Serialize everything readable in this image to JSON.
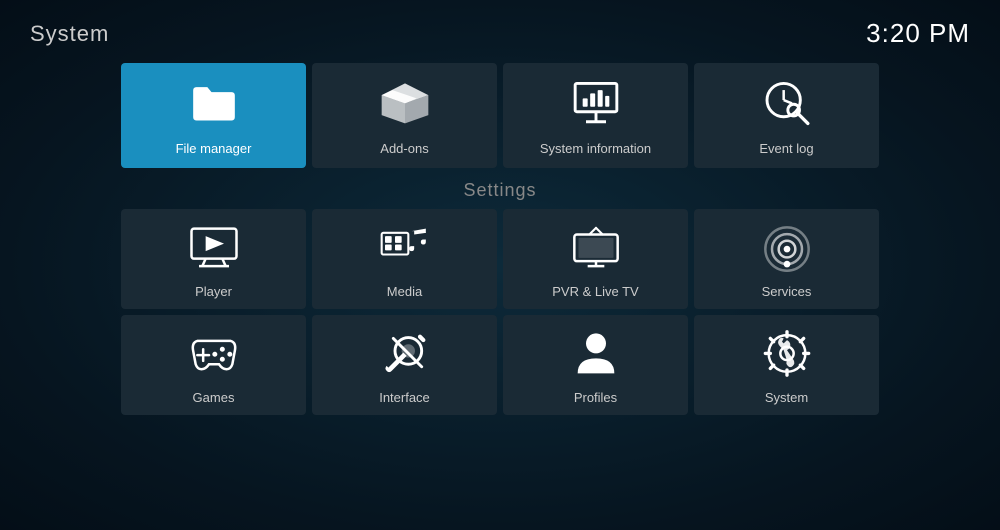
{
  "header": {
    "title": "System",
    "time": "3:20 PM"
  },
  "top_row": [
    {
      "id": "file-manager",
      "label": "File manager",
      "active": true,
      "icon": "folder"
    },
    {
      "id": "add-ons",
      "label": "Add-ons",
      "active": false,
      "icon": "box"
    },
    {
      "id": "system-information",
      "label": "System information",
      "active": false,
      "icon": "presentation"
    },
    {
      "id": "event-log",
      "label": "Event log",
      "active": false,
      "icon": "clock-search"
    }
  ],
  "settings": {
    "title": "Settings",
    "row1": [
      {
        "id": "player",
        "label": "Player",
        "icon": "monitor-play"
      },
      {
        "id": "media",
        "label": "Media",
        "icon": "media"
      },
      {
        "id": "pvr-live-tv",
        "label": "PVR & Live TV",
        "icon": "tv"
      },
      {
        "id": "services",
        "label": "Services",
        "icon": "rss"
      }
    ],
    "row2": [
      {
        "id": "games",
        "label": "Games",
        "icon": "gamepad"
      },
      {
        "id": "interface",
        "label": "Interface",
        "icon": "wrench-pencil"
      },
      {
        "id": "profiles",
        "label": "Profiles",
        "icon": "person"
      },
      {
        "id": "system",
        "label": "System",
        "icon": "gear-tools"
      }
    ]
  }
}
